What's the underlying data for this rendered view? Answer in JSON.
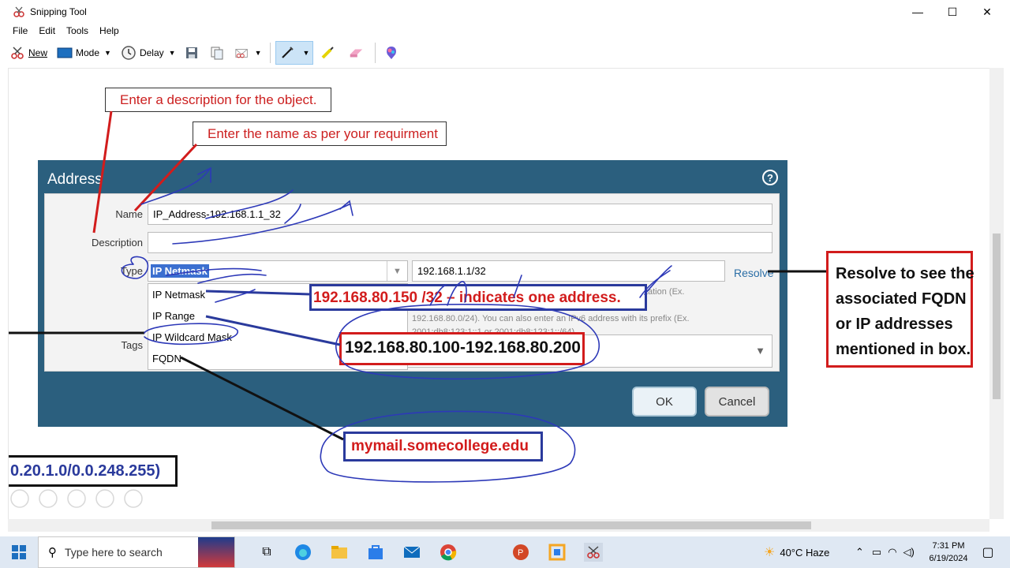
{
  "window": {
    "title": "Snipping Tool",
    "minimize": "—",
    "maximize": "☐",
    "close": "✕"
  },
  "menu": [
    "File",
    "Edit",
    "Tools",
    "Help"
  ],
  "toolbar": {
    "new_label": "New",
    "mode_label": "Mode",
    "delay_label": "Delay"
  },
  "callouts": {
    "description": "Enter a description for the object.",
    "name": "Enter the name as per your requirment"
  },
  "dialog": {
    "title": "Address",
    "help": "?",
    "labels": {
      "name": "Name",
      "description": "Description",
      "type": "Type",
      "tags": "Tags"
    },
    "name_value": "IP_Address-192.168.1.1_32",
    "description_value": "",
    "type_value": "IP Netmask",
    "address_value": "192.168.1.1/32",
    "resolve": "Resolve",
    "type_options": [
      "IP Netmask",
      "IP Range",
      "IP Wildcard Mask",
      "FQDN"
    ],
    "hint_lines": [
      "Enter an IPv4 address or an IPv6 address using the slash notation (Ex. 192.168.80.150 or",
      "192.168.80.0/24). You can also enter an IPv6 address with its prefix (Ex.",
      "2001:db8:123:1::1 or 2001:db8:123:1::/64)"
    ],
    "ok": "OK",
    "cancel": "Cancel"
  },
  "annotations": {
    "netmask": "192.168.80.150 /32 – indicates one address.",
    "range": "192.168.80.100-192.168.80.200",
    "fqdn": "mymail.somecollege.edu",
    "wildcard": "0.20.1.0/0.0.248.255)",
    "resolve_lines": [
      "Resolve to see the",
      "associated FQDN",
      "or IP addresses",
      "mentioned in box."
    ]
  },
  "taskbar": {
    "search_placeholder": "Type here to search",
    "weather": "40°C  Haze",
    "time": "7:31 PM",
    "date": "6/19/2024"
  },
  "colors": {
    "dialog_header": "#2b5f7e",
    "annotation_red": "#d21c1c",
    "annotation_blue": "#2a3a9c"
  }
}
